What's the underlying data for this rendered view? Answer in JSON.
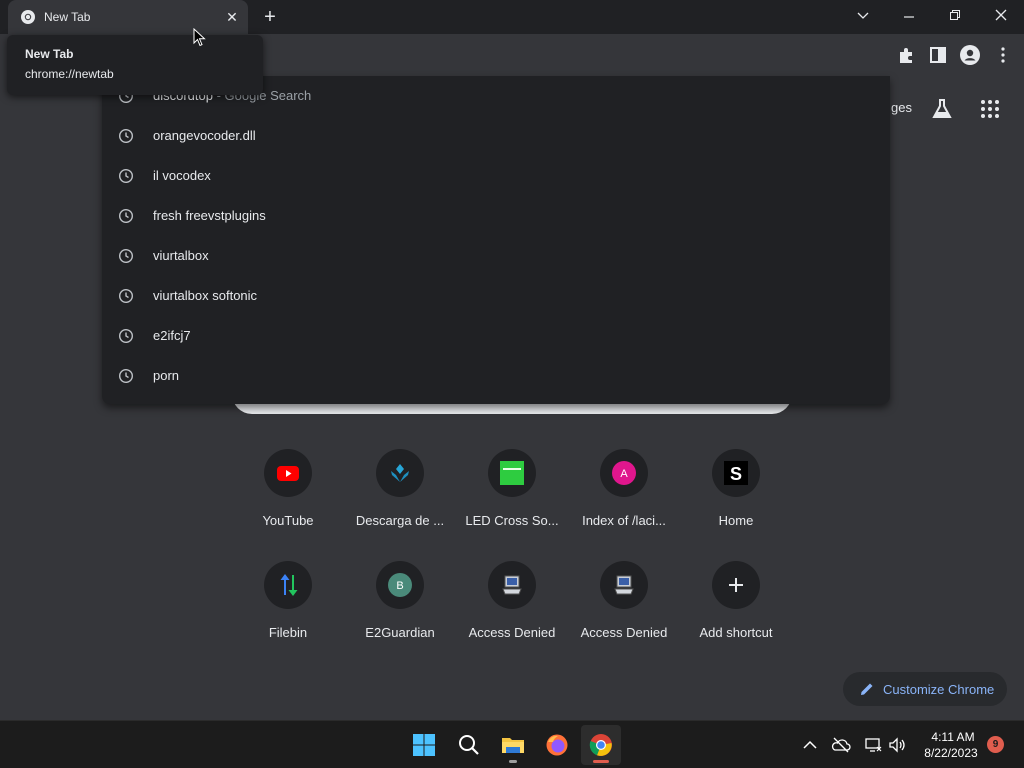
{
  "tab": {
    "title": "New Tab",
    "favicon": "chrome-icon"
  },
  "tooltip": {
    "title": "New Tab",
    "url": "chrome://newtab"
  },
  "page": {
    "images_link_partial": "ges"
  },
  "suggestions": [
    {
      "text": "discordtop",
      "sub": " - Google Search",
      "icon": "clock-icon"
    },
    {
      "text": "orangevocoder.dll",
      "sub": "",
      "icon": "clock-icon"
    },
    {
      "text": "il vocodex",
      "sub": "",
      "icon": "clock-icon"
    },
    {
      "text": "fresh freevstplugins",
      "sub": "",
      "icon": "clock-icon"
    },
    {
      "text": "viurtalbox",
      "sub": "",
      "icon": "clock-icon"
    },
    {
      "text": "viurtalbox softonic",
      "sub": "",
      "icon": "clock-icon"
    },
    {
      "text": "e2ifcj7",
      "sub": "",
      "icon": "clock-icon"
    },
    {
      "text": "porn",
      "sub": "",
      "icon": "clock-icon"
    }
  ],
  "shortcuts": [
    {
      "label": "YouTube",
      "icon": "youtube-icon"
    },
    {
      "label": "Descarga de ...",
      "icon": "descarga-icon"
    },
    {
      "label": "LED Cross So...",
      "icon": "led-icon"
    },
    {
      "label": "Index of /laci...",
      "icon": "letter-a-icon",
      "letter": "A"
    },
    {
      "label": "Home",
      "icon": "home-s-icon",
      "letter": "S"
    },
    {
      "label": "Filebin",
      "icon": "filebin-icon"
    },
    {
      "label": "E2Guardian",
      "icon": "letter-b-icon",
      "letter": "B"
    },
    {
      "label": "Access Denied",
      "icon": "access-denied-icon"
    },
    {
      "label": "Access Denied",
      "icon": "access-denied-icon"
    },
    {
      "label": "Add shortcut",
      "icon": "plus-icon"
    }
  ],
  "customize": {
    "label": "Customize Chrome"
  },
  "taskbar": {
    "time": "4:11 AM",
    "date": "8/22/2023",
    "notifications": "9"
  },
  "colors": {
    "accent_blue": "#8ab4f8",
    "page_bg": "#35363a",
    "dropdown_bg": "#202124"
  }
}
